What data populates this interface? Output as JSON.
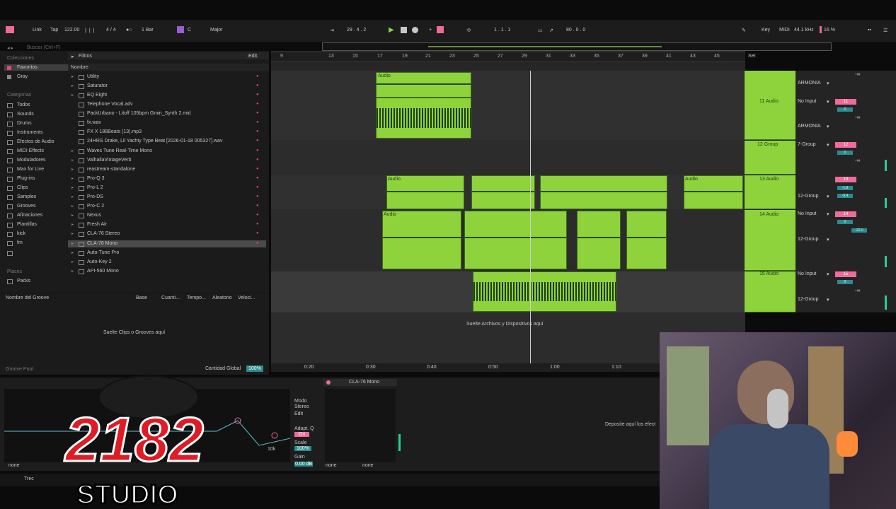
{
  "transport": {
    "link": "Link",
    "tap": "Tap",
    "tempo": "122.00",
    "signature": "4 / 4",
    "quantize": "1 Bar",
    "key_root": "C",
    "scale": "Major",
    "position": "29 .  4 .  2",
    "loop_start": "1 .  1 .  1",
    "loop_length": "80 .  0 .  0",
    "key_map": "Key",
    "midi": "MIDI",
    "sample_rate": "44.1 kHz",
    "cpu": "16 %"
  },
  "browser": {
    "search_placeholder": "Buscar (Ctrl+F)",
    "filters": "Filtros",
    "edit": "Edit",
    "col_name": "Nombre",
    "collections_header": "Colecciones",
    "collections": [
      "Favoritos",
      "Gray"
    ],
    "categories_header": "Categorías",
    "categories": [
      "Todos",
      "Sounds",
      "Drums",
      "Instruments",
      "Efectos de Audio",
      "MIDI Effects",
      "Moduladores",
      "Max for Live",
      "Plug-ins",
      "Clips",
      "Samples",
      "Grooves",
      "Afinaciones",
      "Plantillas",
      "kick",
      "fm",
      "Packs"
    ],
    "places_header": "Places",
    "files": [
      "Utility",
      "Saturator",
      "EQ Eight",
      "Telephone Vocal.adv",
      "PackUrbano - Litoff 105bpm Gmin_Synth 2.mid",
      "fx.wav",
      "FX X 188Beats (13).mp3",
      "24HRS Drake, Lil Yachty Type Beat [2026-01-18 005327].wav",
      "Waves Tune Real-Time Mono",
      "ValhallaVintageVerb",
      "reastream-standalone",
      "Pro-Q 3",
      "Pro-L 2",
      "Pro-DS",
      "Pro-C 2",
      "Nexus",
      "Fresh Air",
      "CLA-76 Stereo",
      "CLA-76 Mono",
      "Auto-Tune Pro",
      "Auto-Key 2",
      "API-560 Mono"
    ],
    "selected_file": "CLA-76 Mono"
  },
  "groove_pool": {
    "col_name": "Nombre del Groove",
    "col_base": "Base",
    "col_quant": "Cuanti...",
    "col_tempo": "Tempo...",
    "col_random": "Aleatorio",
    "col_vel": "Veloci...",
    "drop_hint": "Suelte Clips o Grooves aquí",
    "global_amount_label": "Cantidad Global",
    "global_amount": "100%",
    "footer": "Groove Pool"
  },
  "ruler": [
    "9",
    "13",
    "15",
    "17",
    "19",
    "21",
    "23",
    "25",
    "27",
    "29",
    "31",
    "33",
    "35",
    "37",
    "39",
    "41",
    "43",
    "45"
  ],
  "time_ruler": [
    "0:20",
    "0:30",
    "0:40",
    "0:50",
    "1:00",
    "1:10"
  ],
  "arrangement": {
    "drop_hint": "Suelte Archivos y Dispositivos aquí",
    "set_label": "Set",
    "clip_label": "Audio"
  },
  "tracks": [
    {
      "name": "",
      "input": "ARMONIA",
      "number": "",
      "send": "-∞"
    },
    {
      "name": "11 Audio",
      "input": "No Input",
      "group": "ARMONIA",
      "number": "11",
      "vol": "0",
      "send": "-∞"
    },
    {
      "name": "12 Group",
      "input": "7-Group",
      "number": "12",
      "vol": "0",
      "send": "-∞"
    },
    {
      "name": "13 Audio",
      "input": "12-Group",
      "number": "13",
      "vol": "-1.8",
      "send": "-9.4"
    },
    {
      "name": "14 Audio",
      "input": "No Input",
      "group": "12-Group",
      "number": "14",
      "vol": "0",
      "send": "-22.0"
    },
    {
      "name": "15 Audio",
      "input": "No Input",
      "group": "12-Group",
      "number": "15",
      "vol": "0",
      "send": "-∞"
    }
  ],
  "devices": {
    "device1": {
      "mode_label": "Modo",
      "mode_value": "Stereo",
      "edit": "Edit",
      "adapt_q": "Adapt. Q",
      "adapt_q_value": "On",
      "scale_label": "Scale",
      "scale_value": "100%",
      "gain_label": "Gain",
      "gain_value": "0.00 dB",
      "freq_label": "10k",
      "chain_a": "none",
      "chain_b": "none"
    },
    "device2": {
      "title": "CLA-76 Mono",
      "chain_a": "none",
      "chain_b": "none"
    },
    "drop_hint": "Deposite aquí los efect"
  },
  "logo": {
    "number": "2182",
    "word": "STUDIO"
  },
  "status": {
    "left": "Trec"
  },
  "colors": {
    "clip_green": "#8fd33c",
    "accent_pink": "#f06b9a",
    "teal": "#2a8c90"
  }
}
